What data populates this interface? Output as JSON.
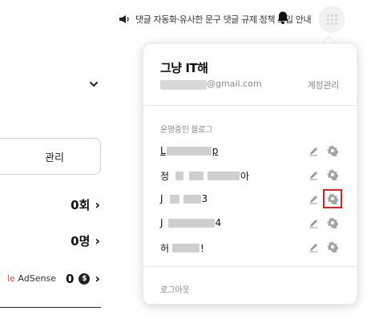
{
  "header": {
    "notice_text": "댓글 자동화·유사한 문구 댓글 규제 정책 도입 안내",
    "notice_icon": "megaphone-icon",
    "bell_icon": "bell-icon",
    "avatar_icon": "avatar-icon"
  },
  "background": {
    "manage_label": "관리",
    "stats": [
      {
        "value": "0회",
        "arrow": "›"
      },
      {
        "value": "0명",
        "arrow": "›"
      },
      {
        "label_prefix": "le",
        "label": " AdSense",
        "value": "0",
        "currency_icon": "$",
        "arrow": "›"
      }
    ]
  },
  "dropdown": {
    "title": "그냥 IT해",
    "email_suffix": "@gmail.com",
    "account_link": "계정관리",
    "section_label": "운영중인 블로그",
    "blogs": [
      {
        "prefix": "L",
        "suffix": "p"
      },
      {
        "prefix": "정",
        "suffix": "아"
      },
      {
        "prefix": "J",
        "suffix": "3"
      },
      {
        "prefix": "J",
        "suffix": "4"
      },
      {
        "prefix": "허",
        "suffix": "!"
      }
    ],
    "logout_label": "로그아웃"
  },
  "colors": {
    "highlight": "#e02020",
    "adsense_g": "#e8453c"
  }
}
